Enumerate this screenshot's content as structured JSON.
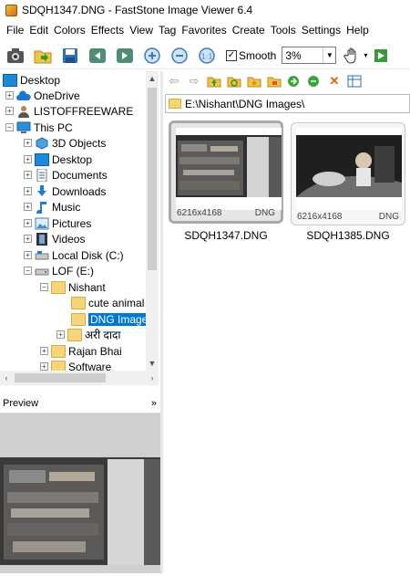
{
  "window": {
    "title": "SDQH1347.DNG  -  FastStone Image Viewer 6.4"
  },
  "menu": [
    "File",
    "Edit",
    "Colors",
    "Effects",
    "View",
    "Tag",
    "Favorites",
    "Create",
    "Tools",
    "Settings",
    "Help"
  ],
  "toolbar": {
    "smooth_label": "Smooth",
    "smooth_checked": "✓",
    "zoom_value": "3%"
  },
  "tree": {
    "items": [
      {
        "label": "Desktop"
      },
      {
        "label": "OneDrive"
      },
      {
        "label": "LISTOFFREEWARE"
      },
      {
        "label": "This PC"
      },
      {
        "label": "3D Objects"
      },
      {
        "label": "Desktop"
      },
      {
        "label": "Documents"
      },
      {
        "label": "Downloads"
      },
      {
        "label": "Music"
      },
      {
        "label": "Pictures"
      },
      {
        "label": "Videos"
      },
      {
        "label": "Local Disk (C:)"
      },
      {
        "label": "LOF (E:)"
      },
      {
        "label": "Nishant"
      },
      {
        "label": "cute animal"
      },
      {
        "label": "DNG Image"
      },
      {
        "label": "अरी दादा"
      },
      {
        "label": "Rajan Bhai"
      },
      {
        "label": "Software"
      }
    ]
  },
  "preview": {
    "label": "Preview",
    "collapse_glyph": "»"
  },
  "path": {
    "value": "E:\\Nishant\\DNG Images\\"
  },
  "thumbnails": [
    {
      "filename": "SDQH1347.DNG",
      "dimensions": "6216x4168",
      "format": "DNG"
    },
    {
      "filename": "SDQH1385.DNG",
      "dimensions": "6216x4168",
      "format": "DNG"
    }
  ],
  "colors": {
    "selection": "#0078d7",
    "folder": "#f6d47a"
  }
}
